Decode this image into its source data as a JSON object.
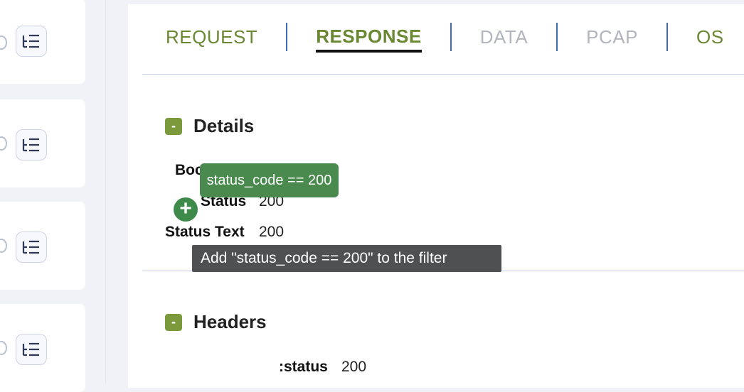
{
  "tabs": [
    {
      "label": "REQUEST",
      "state": "green"
    },
    {
      "label": "RESPONSE",
      "state": "active"
    },
    {
      "label": "DATA",
      "state": "muted"
    },
    {
      "label": "PCAP",
      "state": "muted"
    },
    {
      "label": "OS",
      "state": "green"
    }
  ],
  "details": {
    "collapse_symbol": "-",
    "title": "Details",
    "body_label_partial": "Boc",
    "status_label": "Status",
    "status_value": "200",
    "status_text_label": "Status Text",
    "status_text_value": "200"
  },
  "filter_chip": {
    "text": "status_code == 200"
  },
  "add_button": {
    "symbol": "+"
  },
  "tooltip": {
    "text": "Add \"status_code == 200\" to the filter"
  },
  "headers": {
    "collapse_symbol": "-",
    "title": "Headers",
    "status_label": ":status",
    "status_value": "200"
  },
  "sidebar": {
    "entries": [
      {
        "icon": "tree-list-icon"
      },
      {
        "icon": "tree-list-icon"
      },
      {
        "icon": "tree-list-icon"
      },
      {
        "icon": "tree-list-icon"
      }
    ]
  },
  "colors": {
    "accent_green": "#6a8832",
    "chip_green": "#4a8a4e",
    "separator_blue": "#3d6fb0",
    "tooltip_bg": "#4f5052"
  }
}
